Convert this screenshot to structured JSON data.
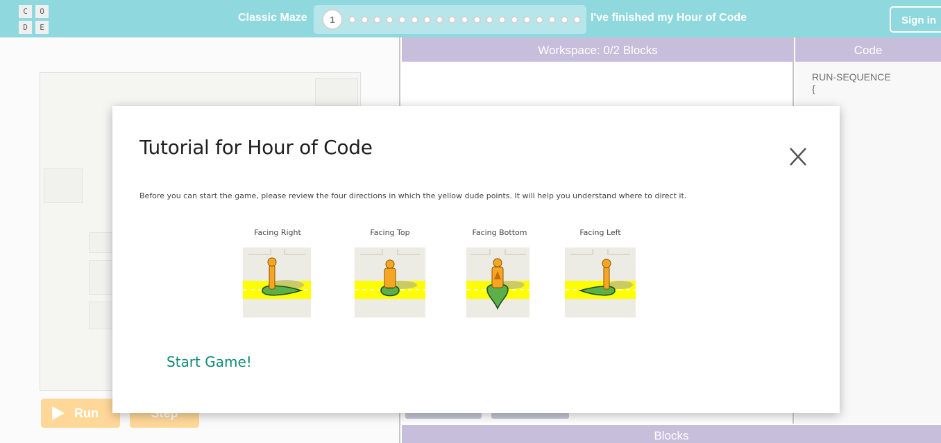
{
  "header": {
    "logo_letters": [
      "C",
      "O",
      "D",
      "E"
    ],
    "puzzle_name": "Classic Maze",
    "current_level": "1",
    "progress_dot_count": 19,
    "finish_text": "I've finished my Hour of Code",
    "signin_label": "Sign in"
  },
  "left_pane": {
    "run_label": "Run",
    "step_label": "Step"
  },
  "workspace": {
    "header": "Workspace: 0/2 Blocks"
  },
  "code": {
    "header": "Code",
    "lines": [
      "RUN-SEQUENCE",
      "{"
    ]
  },
  "blocks": {
    "header": "Blocks"
  },
  "modal": {
    "title": "Tutorial for Hour of Code",
    "close_icon": "close-icon",
    "description": "Before you can start the game, please review the four directions in which the yellow dude points. It will help you understand where to direct it.",
    "directions": [
      {
        "label": "Facing Right",
        "icon": "character-facing-right"
      },
      {
        "label": "Facing Top",
        "icon": "character-facing-top"
      },
      {
        "label": "Facing Bottom",
        "icon": "character-facing-bottom"
      },
      {
        "label": "Facing Left",
        "icon": "character-facing-left"
      }
    ],
    "start_label": "Start Game!"
  },
  "colors": {
    "header_bg": "#8fd9de",
    "panel_header": "#c7bedb",
    "run_button": "#ffd899",
    "path_yellow": "#ffff00",
    "pegman_green": "#5bb04a",
    "pegman_orange": "#f5a623",
    "link_green": "#0f8a78"
  }
}
